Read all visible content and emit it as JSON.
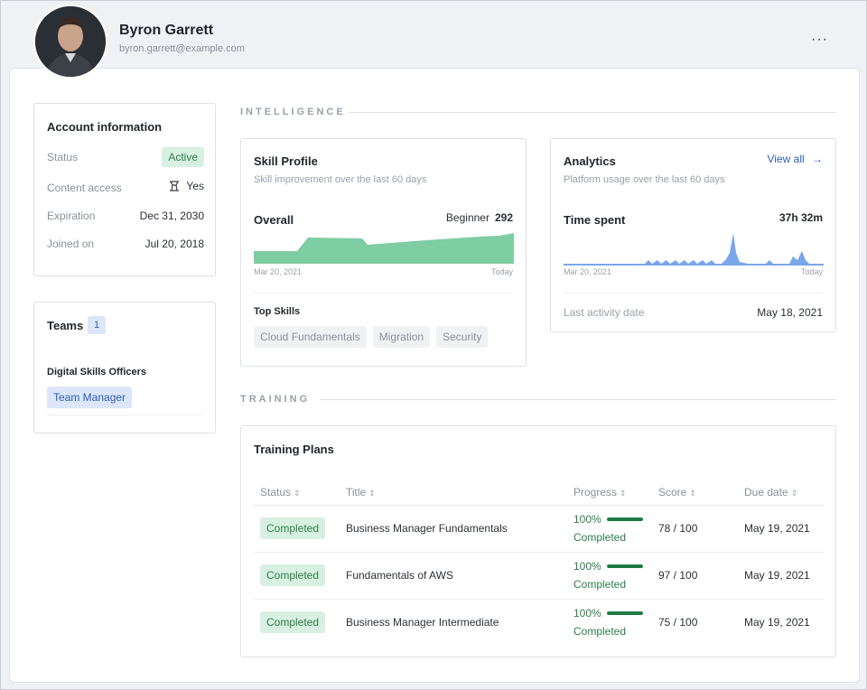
{
  "user": {
    "name": "Byron Garrett",
    "email": "byron.garrett@example.com",
    "more_menu": "···"
  },
  "account": {
    "title": "Account information",
    "rows": [
      {
        "label": "Status",
        "value": "Active"
      },
      {
        "label": "Content access",
        "value": "Yes"
      },
      {
        "label": "Expiration",
        "value": "Dec 31, 2030"
      },
      {
        "label": "Joined on",
        "value": "Jul 20, 2018"
      }
    ]
  },
  "teams": {
    "title": "Teams",
    "count": "1",
    "team_name": "Digital Skills Officers",
    "role": "Team Manager"
  },
  "sections": {
    "intelligence": "INTELLIGENCE",
    "training": "TRAINING"
  },
  "skill_profile": {
    "title": "Skill Profile",
    "subtitle": "Skill improvement over the last 60 days",
    "overall_label": "Overall",
    "level": "Beginner",
    "score": "292",
    "axis_start": "Mar 20, 2021",
    "axis_end": "Today",
    "top_skills_label": "Top Skills",
    "top_skills": [
      "Cloud Fundamentals",
      "Migration",
      "Security"
    ],
    "chart_color": "#7fcda3"
  },
  "analytics": {
    "title": "Analytics",
    "view_all": "View all",
    "subtitle": "Platform usage over the last 60 days",
    "time_label": "Time spent",
    "time_value": "37h 32m",
    "axis_start": "Mar 20, 2021",
    "axis_end": "Today",
    "last_activity_label": "Last activity date",
    "last_activity_value": "May 18, 2021",
    "chart_color": "#7aa6ea"
  },
  "training": {
    "title": "Training Plans",
    "columns": [
      "Status",
      "Title",
      "Progress",
      "Score",
      "Due date"
    ],
    "rows": [
      {
        "status": "Completed",
        "title": "Business Manager Fundamentals",
        "progress_pct": "100%",
        "progress_value": 1.0,
        "progress_text": "Completed",
        "score": "78 / 100",
        "due": "May 19, 2021"
      },
      {
        "status": "Completed",
        "title": "Fundamentals of AWS",
        "progress_pct": "100%",
        "progress_value": 1.0,
        "progress_text": "Completed",
        "score": "97 / 100",
        "due": "May 19, 2021"
      },
      {
        "status": "Completed",
        "title": "Business Manager Intermediate",
        "progress_pct": "100%",
        "progress_value": 1.0,
        "progress_text": "Completed",
        "score": "75 / 100",
        "due": "May 19, 2021"
      }
    ]
  },
  "colors": {
    "accent": "#2d5fb5",
    "success": "#2e7d4c",
    "success_bg": "#d7f0e1"
  }
}
